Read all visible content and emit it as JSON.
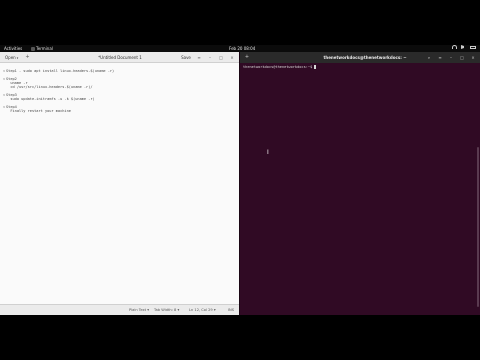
{
  "topbar": {
    "activities": "Activities",
    "app_name": "Terminal",
    "clock": "Feb 20  08:04",
    "status_icons": [
      "network-icon",
      "volume-icon",
      "battery-icon"
    ]
  },
  "editor": {
    "open_label": "Open",
    "new_label": "+",
    "title": "*Untitled Document 1",
    "save_label": "Save",
    "menu_icon": "≡",
    "min_icon": "–",
    "max_icon": "□",
    "close_icon": "×",
    "lines": [
      {
        "fold": "",
        "text": ""
      },
      {
        "fold": "v",
        "text": "Step1 - sudo apt install linux-headers-$(uname -r)"
      },
      {
        "fold": "",
        "text": ""
      },
      {
        "fold": "v",
        "text": "Step2"
      },
      {
        "fold": "",
        "text": "  uname -r"
      },
      {
        "fold": "",
        "text": "  cd /usr/src/linux-headers-$(uname -r)/"
      },
      {
        "fold": "",
        "text": ""
      },
      {
        "fold": "v",
        "text": "Step3"
      },
      {
        "fold": "",
        "text": "  sudo update-initramfs -u -k $(uname -r)"
      },
      {
        "fold": "",
        "text": ""
      },
      {
        "fold": "v",
        "text": "Step4"
      },
      {
        "fold": "",
        "text": "  Finally restart your machine"
      }
    ],
    "status": {
      "format": "Plain Text ▾",
      "tab_width": "Tab Width: 8 ▾",
      "position": "Ln 12, Col 29 ▾",
      "mode": "INS"
    }
  },
  "terminal": {
    "new_tab_icon": "+",
    "title": "thenetworkdocs@thenetworkdocs: ~",
    "search_icon": "⌕",
    "menu_icon": "≡",
    "min_icon": "–",
    "max_icon": "□",
    "close_icon": "×",
    "prompt": "thenetworkdocs@thenetworkdocs:~$ "
  }
}
